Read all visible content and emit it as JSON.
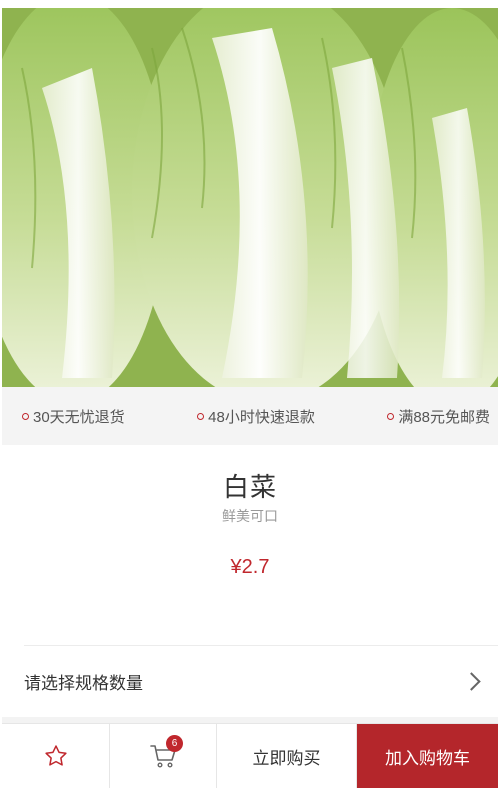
{
  "product": {
    "image_alt": "",
    "name": "白菜",
    "tagline": "鲜美可口",
    "price": "¥2.7"
  },
  "guarantees": [
    {
      "label": "30天无忧退货"
    },
    {
      "label": "48小时快速退款"
    },
    {
      "label": "满88元免邮费"
    }
  ],
  "spec": {
    "label": "请选择规格数量",
    "icon": "chevron-right-icon"
  },
  "bottom_bar": {
    "favorite_icon": "star-icon",
    "cart_icon": "cart-icon",
    "cart_count": "6",
    "buy_now_label": "立即购买",
    "add_to_cart_label": "加入购物车"
  },
  "colors": {
    "accent": "#c0272d",
    "add_button_bg": "#b4262b",
    "guarantee_bg": "#f4f4f4"
  }
}
